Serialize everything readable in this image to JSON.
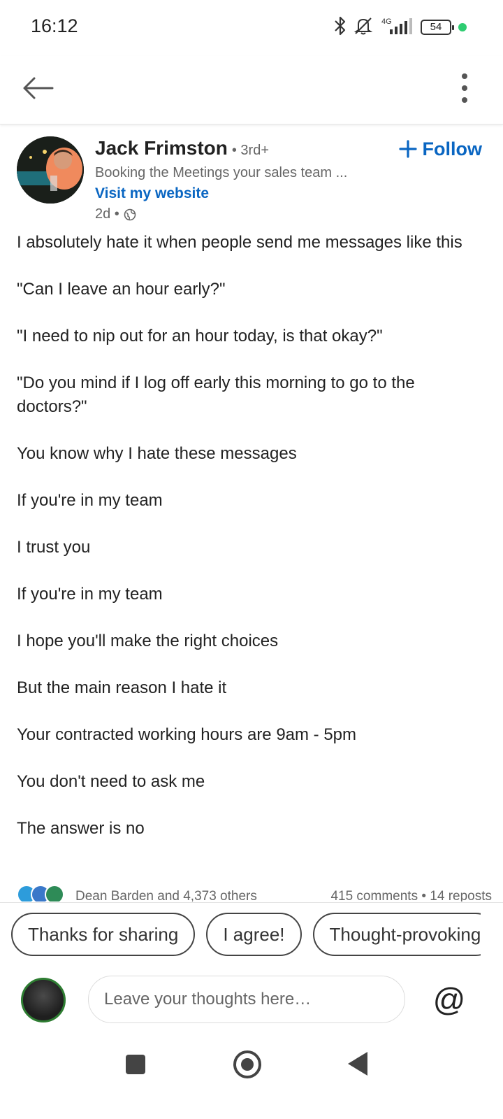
{
  "status_bar": {
    "time": "16:12",
    "network": "4G",
    "battery": "54",
    "icons": [
      "bluetooth-icon",
      "bell-off-icon",
      "signal-icon",
      "battery-icon",
      "green-dot-icon"
    ]
  },
  "app_bar": {
    "back_icon": "arrow-left-icon",
    "more_icon": "more-vertical-icon"
  },
  "post": {
    "author": {
      "name": "Jack Frimston",
      "degree": "• 3rd+",
      "headline": "Booking the Meetings your sales team ...",
      "link": "Visit my website",
      "time": "2d •"
    },
    "follow_label": "Follow",
    "paragraphs": [
      "I absolutely hate it when people send me messages like this",
      "\"Can I leave an hour early?\"",
      "\"I need to nip out for an hour today, is that okay?\"",
      "\"Do you mind if I log off early this morning to go to the doctors?\"",
      "You know why I hate these messages",
      "If you're in my team",
      "I trust you",
      "If you're in my team",
      "I hope you'll make the right choices",
      "But the main reason I hate it",
      "Your contracted working hours are 9am - 5pm",
      "You don't need to ask me",
      "The answer is no"
    ],
    "social": {
      "reactions_text": "Dean Barden and 4,373 others",
      "counts_text": "415 comments • 14 reposts"
    }
  },
  "chips": [
    "Thanks for sharing",
    "I agree!",
    "Thought-provoking"
  ],
  "composer": {
    "placeholder": "Leave your thoughts here…",
    "mention": "@"
  },
  "colors": {
    "link_blue": "#0a66c2",
    "text": "#222222",
    "muted": "#666666"
  }
}
